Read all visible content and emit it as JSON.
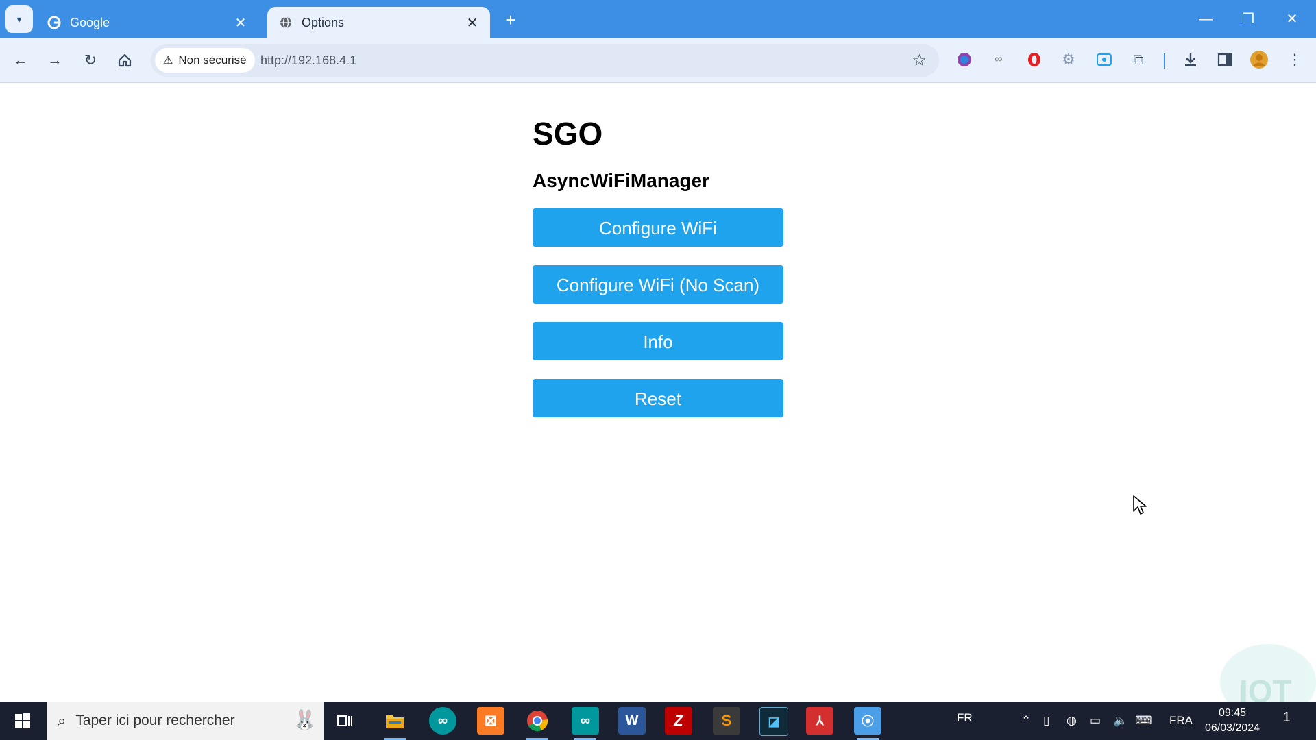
{
  "browser": {
    "tabs": [
      {
        "label": "Google",
        "favicon": "google-icon"
      },
      {
        "label": "Options",
        "favicon": "globe-icon"
      }
    ],
    "security_label": "Non sécurisé",
    "url": "http://192.168.4.1"
  },
  "page": {
    "title": "SGO",
    "subtitle": "AsyncWiFiManager",
    "buttons": {
      "configure_wifi": "Configure WiFi",
      "configure_wifi_noscan": "Configure WiFi (No Scan)",
      "info": "Info",
      "reset": "Reset"
    },
    "button_color": "#1fa3ec"
  },
  "taskbar": {
    "search_placeholder": "Taper ici pour rechercher",
    "lang_short": "FR",
    "lang": "FRA",
    "time": "09:45",
    "date": "06/03/2024",
    "notification_count": "1"
  },
  "watermark": "IOT"
}
